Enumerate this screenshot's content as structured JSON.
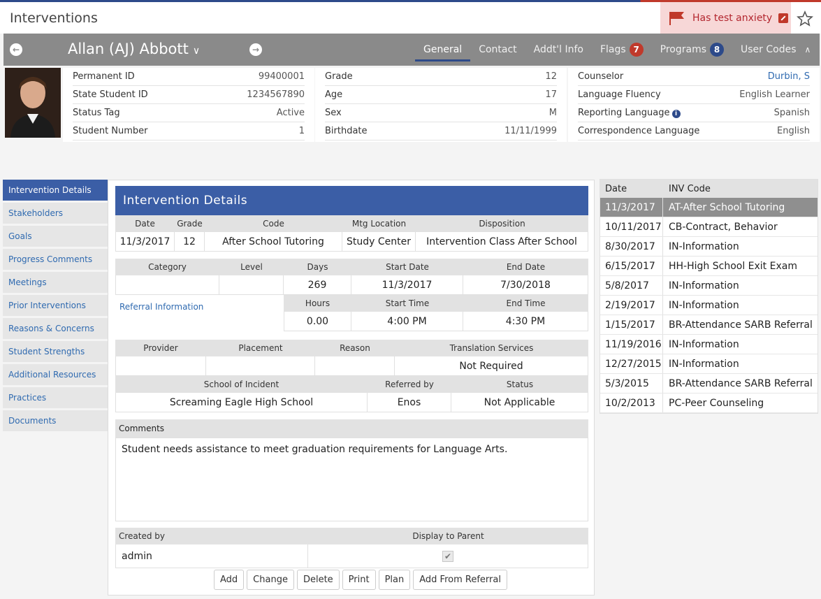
{
  "page_title": "Interventions",
  "alert": {
    "text": "Has test anxiety",
    "color": "#b3262f"
  },
  "student": {
    "name": "Allan (AJ) Abbott"
  },
  "nav_tabs": [
    {
      "label": "General",
      "active": true
    },
    {
      "label": "Contact"
    },
    {
      "label": "Addt'l Info"
    },
    {
      "label": "Flags",
      "badge": "7"
    },
    {
      "label": "Programs",
      "badge": "8"
    },
    {
      "label": "User Codes"
    }
  ],
  "info_col1": [
    {
      "label": "Permanent ID",
      "value": "99400001"
    },
    {
      "label": "State Student ID",
      "value": "1234567890"
    },
    {
      "label": "Status Tag",
      "value": "Active"
    },
    {
      "label": "Student Number",
      "value": "1"
    }
  ],
  "info_col2": [
    {
      "label": "Grade",
      "value": "12"
    },
    {
      "label": "Age",
      "value": "17"
    },
    {
      "label": "Sex",
      "value": "M"
    },
    {
      "label": "Birthdate",
      "value": "11/11/1999"
    }
  ],
  "info_col3": [
    {
      "label": "Counselor",
      "value": "Durbin, S"
    },
    {
      "label": "Language Fluency",
      "value": "English Learner"
    },
    {
      "label": "Reporting Language",
      "value": "Spanish"
    },
    {
      "label": "Correspondence Language",
      "value": "English"
    }
  ],
  "side_menu": [
    "Intervention Details",
    "Stakeholders",
    "Goals",
    "Progress Comments",
    "Meetings",
    "Prior Interventions",
    "Reasons & Concerns",
    "Student Strengths",
    "Additional Resources",
    "Practices",
    "Documents"
  ],
  "panel_title": "Intervention Details",
  "block1": {
    "headers": [
      "Date",
      "Grade",
      "Code",
      "Mtg Location",
      "Disposition"
    ],
    "values": [
      "11/3/2017",
      "12",
      "After School Tutoring",
      "Study Center",
      "Intervention Class After School"
    ]
  },
  "block2": {
    "headers": [
      "Category",
      "Level",
      "Days",
      "Start Date",
      "End Date"
    ],
    "values": [
      "",
      "",
      "269",
      "11/3/2017",
      "7/30/2018"
    ],
    "referral_link": "Referral Information",
    "headers2": [
      "Hours",
      "Start Time",
      "End Time"
    ],
    "values2": [
      "0.00",
      "4:00 PM",
      "4:30 PM"
    ]
  },
  "block3": {
    "headers": [
      "Provider",
      "Placement",
      "Reason",
      "Translation Services"
    ],
    "values": [
      "",
      "",
      "",
      "Not Required"
    ],
    "headers2": [
      "School of Incident",
      "Referred by",
      "Status"
    ],
    "values2": [
      "Screaming Eagle High School",
      "Enos",
      "Not Applicable"
    ]
  },
  "comments": {
    "label": "Comments",
    "text": "Student needs assistance to meet graduation requirements for Language Arts."
  },
  "footer": {
    "created_by_label": "Created by",
    "display_parent_label": "Display to Parent",
    "created_by": "admin",
    "display_to_parent": true
  },
  "buttons": [
    "Add",
    "Change",
    "Delete",
    "Print",
    "Plan",
    "Add From Referral"
  ],
  "history": {
    "headers": [
      "Date",
      "INV Code"
    ],
    "rows": [
      {
        "date": "11/3/2017",
        "code": "AT-After School Tutoring",
        "selected": true
      },
      {
        "date": "10/11/2017",
        "code": "CB-Contract, Behavior"
      },
      {
        "date": "8/30/2017",
        "code": "IN-Information"
      },
      {
        "date": "6/15/2017",
        "code": "HH-High School Exit Exam"
      },
      {
        "date": "5/8/2017",
        "code": "IN-Information"
      },
      {
        "date": "2/19/2017",
        "code": "IN-Information"
      },
      {
        "date": "1/15/2017",
        "code": "BR-Attendance SARB Referral"
      },
      {
        "date": "11/19/2016",
        "code": "IN-Information"
      },
      {
        "date": "12/27/2015",
        "code": "IN-Information"
      },
      {
        "date": "5/3/2015",
        "code": "BR-Attendance SARB Referral"
      },
      {
        "date": "10/2/2013",
        "code": "PC-Peer Counseling"
      }
    ]
  }
}
